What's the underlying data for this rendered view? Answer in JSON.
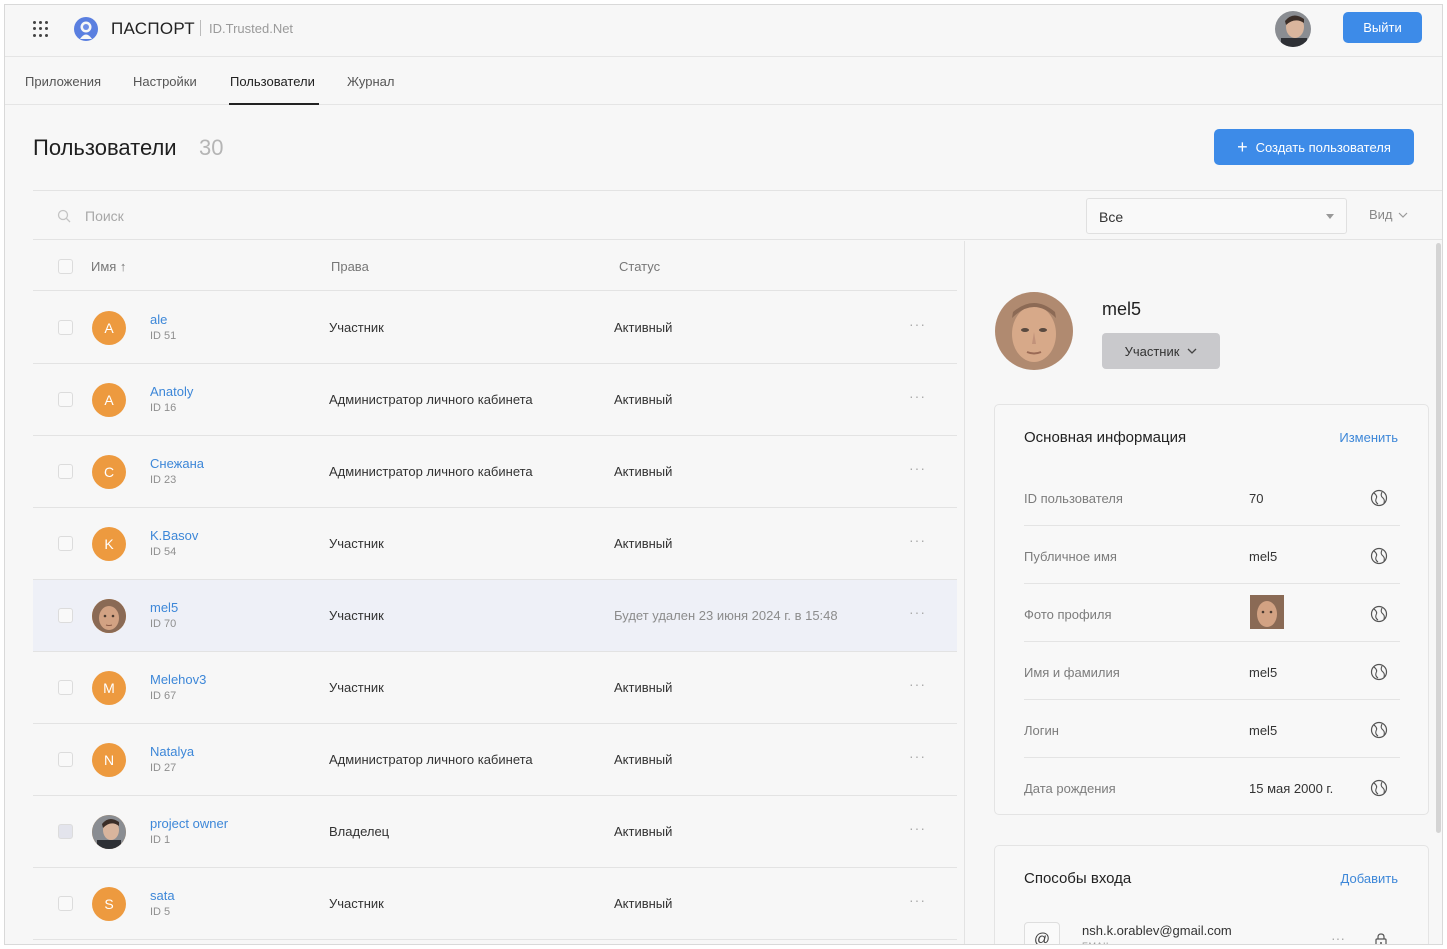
{
  "header": {
    "brand": "ПАСПОРТ",
    "brand_sub": "ID.Trusted.Net",
    "logout_label": "Выйти"
  },
  "tabs": [
    {
      "label": "Приложения",
      "active": false
    },
    {
      "label": "Настройки",
      "active": false
    },
    {
      "label": "Пользователи",
      "active": true
    },
    {
      "label": "Журнал",
      "active": false
    }
  ],
  "page": {
    "title": "Пользователи",
    "count": "30",
    "create_label": "Создать пользователя"
  },
  "search": {
    "placeholder": "Поиск",
    "filter_value": "Все",
    "view_label": "Вид"
  },
  "table": {
    "columns": {
      "name": "Имя ↑",
      "rights": "Права",
      "status": "Статус"
    },
    "rows": [
      {
        "initial": "A",
        "name": "ale",
        "id": "ID 51",
        "role": "Участник",
        "status": "Активный",
        "avatar": "letter"
      },
      {
        "initial": "A",
        "name": "Anatoly",
        "id": "ID 16",
        "role": "Администратор личного кабинета",
        "status": "Активный",
        "avatar": "letter"
      },
      {
        "initial": "С",
        "name": "Снежана",
        "id": "ID 23",
        "role": "Администратор личного кабинета",
        "status": "Активный",
        "avatar": "letter"
      },
      {
        "initial": "K",
        "name": "K.Basov",
        "id": "ID 54",
        "role": "Участник",
        "status": "Активный",
        "avatar": "letter"
      },
      {
        "initial": "",
        "name": "mel5",
        "id": "ID 70",
        "role": "Участник",
        "status": "Будет удален 23 июня 2024 г. в 15:48",
        "avatar": "photo"
      },
      {
        "initial": "M",
        "name": "Melehov3",
        "id": "ID 67",
        "role": "Участник",
        "status": "Активный",
        "avatar": "letter"
      },
      {
        "initial": "N",
        "name": "Natalya",
        "id": "ID 27",
        "role": "Администратор личного кабинета",
        "status": "Активный",
        "avatar": "letter"
      },
      {
        "initial": "",
        "name": "project owner",
        "id": "ID 1",
        "role": "Владелец",
        "status": "Активный",
        "avatar": "photo2"
      },
      {
        "initial": "S",
        "name": "sata",
        "id": "ID 5",
        "role": "Участник",
        "status": "Активный",
        "avatar": "letter"
      }
    ]
  },
  "panel": {
    "name": "mel5",
    "role_label": "Участник",
    "basic_info": {
      "title": "Основная информация",
      "edit_label": "Изменить",
      "rows": [
        {
          "label": "ID пользователя",
          "value": "70"
        },
        {
          "label": "Публичное имя",
          "value": "mel5"
        },
        {
          "label": "Фото профиля",
          "value": ""
        },
        {
          "label": "Имя и фамилия",
          "value": "mel5"
        },
        {
          "label": "Логин",
          "value": "mel5"
        },
        {
          "label": "Дата рождения",
          "value": "15 мая 2000 г."
        }
      ]
    },
    "login_methods": {
      "title": "Способы входа",
      "add_label": "Добавить",
      "icon": "@",
      "email": "nsh.k.orablev@gmail.com",
      "type": "EMAIL"
    }
  },
  "colors": {
    "accent": "#3d8be8",
    "link": "#3d87d8",
    "avatar_orange": "#ed9a3f",
    "selected_row": "#eef0f7"
  }
}
